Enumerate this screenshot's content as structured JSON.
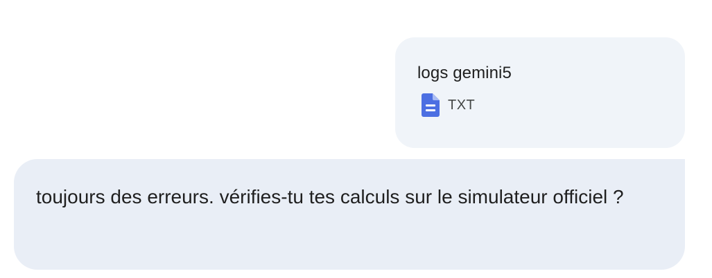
{
  "attachment": {
    "file_name": "logs gemini5",
    "file_type": "TXT",
    "icon": "document-icon",
    "icon_color": "#4c6fe2"
  },
  "message": {
    "text": "toujours des erreurs. vérifies-tu tes calculs sur le simulateur officiel ?"
  },
  "colors": {
    "attachment_bg": "#f0f4f9",
    "message_bg": "#e9eef6",
    "text": "#1f1f1f"
  }
}
